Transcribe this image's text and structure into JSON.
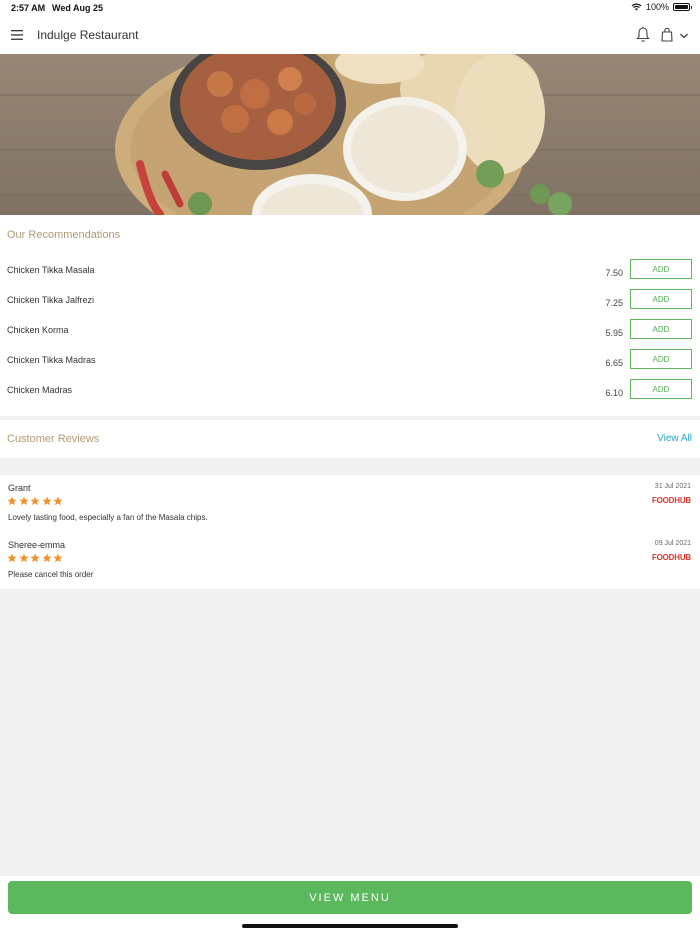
{
  "status_bar": {
    "time": "2:57 AM",
    "date": "Wed Aug 25",
    "battery": "100%"
  },
  "header": {
    "title": "Indulge Restaurant",
    "icons": [
      "hamburger-menu-icon",
      "bell-icon",
      "shopping-bag-icon",
      "chevron-down-icon"
    ]
  },
  "hero": {
    "image": "food-banner (curry, rice, naan, chillies)"
  },
  "recommendations": {
    "title": "Our Recommendations",
    "add_label": "ADD",
    "items": [
      {
        "name": "Chicken Tikka Masala",
        "price": "7.50"
      },
      {
        "name": "Chicken Tikka Jalfrezi",
        "price": "7.25"
      },
      {
        "name": "Chicken Korma",
        "price": "5.95"
      },
      {
        "name": "Chicken Tikka Madras",
        "price": "6.65"
      },
      {
        "name": "Chicken Madras",
        "price": "6.10"
      }
    ]
  },
  "reviews": {
    "title": "Customer Reviews",
    "view_all": "View All",
    "items": [
      {
        "author": "Grant",
        "rating": 5,
        "text": "Lovely tasting food, especially a fan of the Masala chips.",
        "date": "31 Jul 2021",
        "source": "FOODHUB"
      },
      {
        "author": "Sheree-emma",
        "rating": 5,
        "text": "Please cancel this order",
        "date": "09 Jul 2021",
        "source": "FOODHUB"
      }
    ]
  },
  "footer": {
    "view_menu": "VIEW MENU"
  },
  "colors": {
    "accent_green": "#5cb85c",
    "section_title": "#b39a72",
    "link_blue": "#2aa4c8",
    "star_orange": "#f0922b",
    "brand_red": "#d9362b"
  }
}
